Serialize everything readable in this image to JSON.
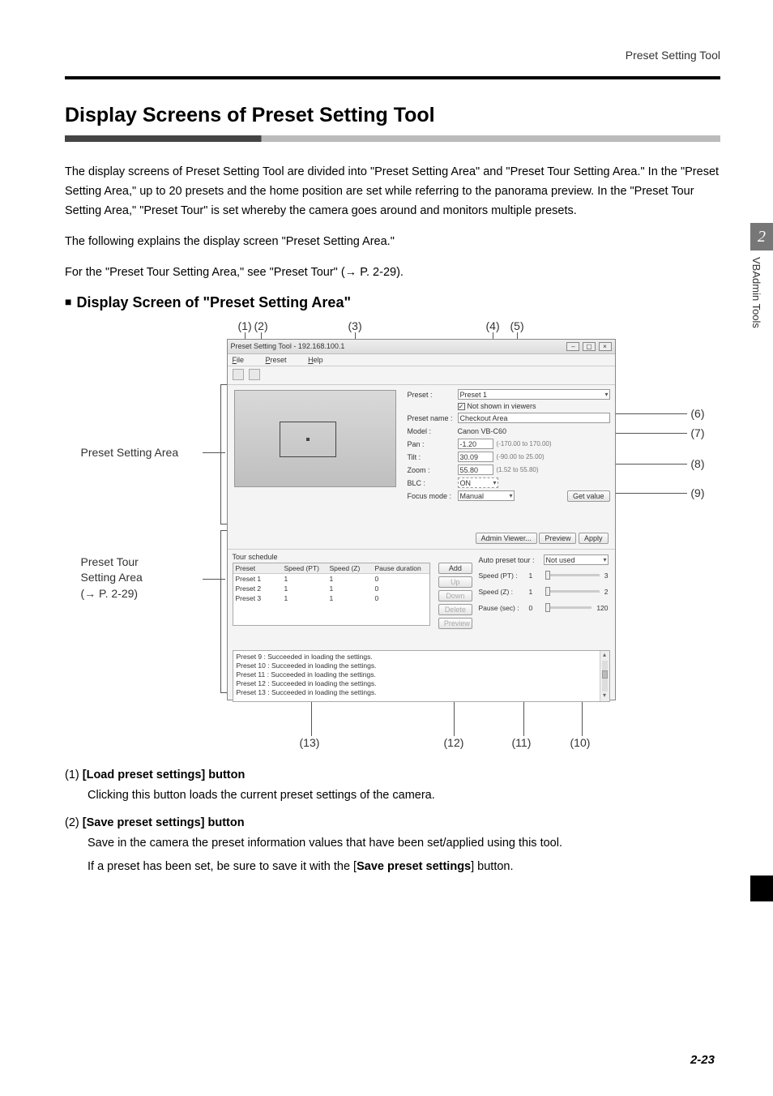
{
  "header": {
    "tool_name": "Preset Setting Tool"
  },
  "side_tab": {
    "chapter": "2",
    "label": "VBAdmin Tools"
  },
  "h1": "Display Screens of Preset Setting Tool",
  "para1": "The display screens of Preset Setting Tool are divided into \"Preset Setting Area\" and \"Preset Tour Setting Area.\" In the \"Preset Setting Area,\" up to 20 presets and the home position are set while referring to the panorama preview. In the \"Preset Tour Setting Area,\" \"Preset Tour\" is set whereby the camera goes around and monitors multiple presets.",
  "para2": "The following explains the display screen \"Preset Setting Area.\"",
  "para3": "For the \"Preset Tour Setting Area,\" see \"Preset Tour\" (→ P. 2-29).",
  "h2": "Display Screen of \"Preset Setting Area\"",
  "callouts": {
    "top": {
      "c1": "(1)",
      "c2": "(2)",
      "c3": "(3)",
      "c4": "(4)",
      "c5": "(5)"
    },
    "right": {
      "c6": "(6)",
      "c7": "(7)",
      "c8": "(8)",
      "c9": "(9)"
    },
    "bottom": {
      "c13": "(13)",
      "c12": "(12)",
      "c11": "(11)",
      "c10": "(10)"
    },
    "left": {
      "area_a": "Preset Setting Area",
      "area_b_l1": "Preset Tour",
      "area_b_l2": "Setting Area",
      "area_b_l3": "(→ P. 2-29)"
    }
  },
  "window": {
    "title": "Preset Setting Tool - 192.168.100.1",
    "menu": {
      "file": "File",
      "preset": "Preset",
      "help": "Help"
    },
    "fields": {
      "preset_lbl": "Preset :",
      "preset_val": "Preset 1",
      "not_shown": "Not shown in viewers",
      "name_lbl": "Preset name :",
      "name_val": "Checkout Area",
      "model_lbl": "Model :",
      "model_val": "Canon VB-C60",
      "pan_lbl": "Pan :",
      "pan_val": "-1.20",
      "pan_hint": "(-170.00 to 170.00)",
      "tilt_lbl": "Tilt :",
      "tilt_val": "30.09",
      "tilt_hint": "(-90.00 to 25.00)",
      "zoom_lbl": "Zoom :",
      "zoom_val": "55.80",
      "zoom_hint": "(1.52 to 55.80)",
      "blc_lbl": "BLC :",
      "blc_val": "ON",
      "focus_lbl": "Focus mode :",
      "focus_val": "Manual",
      "get_value": "Get value"
    },
    "button_row": {
      "admin": "Admin Viewer...",
      "preview": "Preview",
      "apply": "Apply"
    },
    "tour_left": {
      "title": "Tour schedule",
      "head": {
        "c1": "Preset",
        "c2": "Speed (PT)",
        "c3": "Speed (Z)",
        "c4": "Pause duration"
      },
      "rows": [
        {
          "c1": "Preset 1",
          "c2": "1",
          "c3": "1",
          "c4": "0"
        },
        {
          "c1": "Preset 2",
          "c2": "1",
          "c3": "1",
          "c4": "0"
        },
        {
          "c1": "Preset 3",
          "c2": "1",
          "c3": "1",
          "c4": "0"
        }
      ]
    },
    "tour_mid": {
      "add": "Add",
      "up": "Up",
      "down": "Down",
      "delete": "Delete",
      "preview": "Preview"
    },
    "tour_right": {
      "auto_lbl": "Auto preset tour :",
      "auto_val": "Not used",
      "spt_lbl": "Speed (PT) :",
      "spt_v": "1",
      "spt_max": "3",
      "spz_lbl": "Speed (Z) :",
      "spz_v": "1",
      "spz_max": "2",
      "pause_lbl": "Pause (sec) :",
      "pause_v": "0",
      "pause_max": "120"
    },
    "log": [
      "Preset 9 : Succeeded in loading the settings.",
      "Preset 10 : Succeeded in loading the settings.",
      "Preset 11 : Succeeded in loading the settings.",
      "Preset 12 : Succeeded in loading the settings.",
      "Preset 13 : Succeeded in loading the settings."
    ]
  },
  "defs": [
    {
      "num": "(1)",
      "term": "[Load preset settings] button",
      "desc": [
        "Clicking this button loads the current preset settings of the camera."
      ]
    },
    {
      "num": "(2)",
      "term": "[Save preset settings] button",
      "desc": [
        "Save in the camera the preset information values that have been set/applied using this tool.",
        "If a preset has been set, be sure to save it with the [<b>Save preset settings</b>] button."
      ]
    }
  ],
  "page_number": "2-23"
}
